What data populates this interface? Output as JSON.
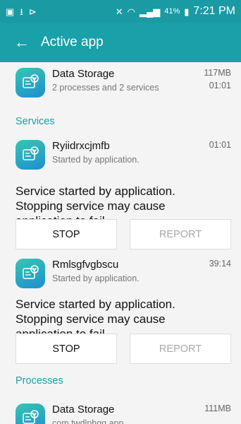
{
  "status_bar": {
    "battery": "41%",
    "time": "7:21 PM"
  },
  "app_bar": {
    "title": "Active app"
  },
  "top_app": {
    "name": "Data Storage",
    "detail": "2 processes and 2 services",
    "size": "117MB",
    "time": "01:01"
  },
  "services_header": "Services",
  "services": [
    {
      "name": "Ryiidrxcjmfb",
      "sub": "Started by application.",
      "time": "01:01",
      "description": "Service started by application. Stopping service may cause application to fail.",
      "stop_label": "STOP",
      "report_label": "REPORT"
    },
    {
      "name": "Rmlsgfvgbscu",
      "sub": "Started by application.",
      "time": "39:14",
      "description": "Service started by application. Stopping service may cause application to fail.",
      "stop_label": "STOP",
      "report_label": "REPORT"
    }
  ],
  "processes_header": "Processes",
  "processes": [
    {
      "name": "Data Storage",
      "sub": "com.twdlphgq.app",
      "size": "111MB"
    }
  ]
}
